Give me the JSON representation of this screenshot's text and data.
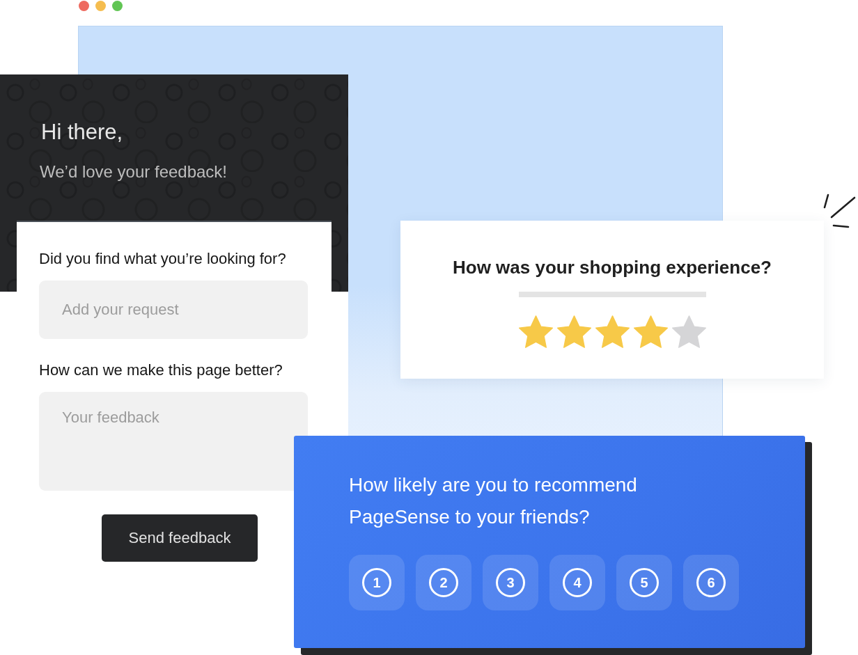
{
  "window": {
    "controls": [
      {
        "color": "#ee6a5f"
      },
      {
        "color": "#f5bd4f"
      },
      {
        "color": "#61c554"
      }
    ]
  },
  "feedback_form": {
    "greeting": "Hi there,",
    "subtitle": "We’d love your feedback!",
    "fields": [
      {
        "kind": "input",
        "label": "Did you find what you’re looking for?",
        "placeholder": "Add your request"
      },
      {
        "kind": "textarea",
        "label": "How can we make this page better?",
        "placeholder": "Your feedback"
      }
    ],
    "submit_button": "Send feedback"
  },
  "rating_card": {
    "question": "How was your shopping experience?",
    "stars": 4
  },
  "nps_card": {
    "question": "How likely are you to recommend PageSense to your friends?",
    "options": [
      "1",
      "2",
      "3",
      "4",
      "5",
      "6"
    ]
  }
}
